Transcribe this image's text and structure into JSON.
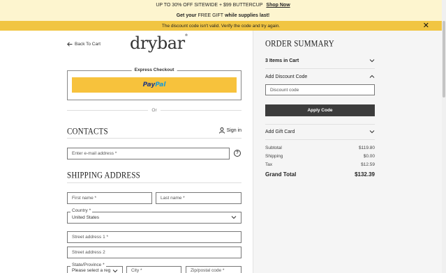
{
  "promo": {
    "line1": "UP TO 30% OFF SITEWIDE + $99 BUTTERCUP",
    "shop_now": "Shop Now",
    "line2_a": "Get your",
    "line2_b": "FREE GIFT",
    "line2_c": "while supplies last!"
  },
  "error": {
    "message": "The discount code isn't valid. Verify the code and try again.",
    "close_icon": "close-icon"
  },
  "header": {
    "back_label": "Back To Cart",
    "logo": "drybar",
    "logo_mark": "®"
  },
  "express": {
    "title": "Express Checkout",
    "paypal_a": "Pay",
    "paypal_b": "Pal",
    "or_label": "Or"
  },
  "contacts": {
    "title": "CONTACTS",
    "signin_label": "Sign in",
    "email_placeholder": "Enter e-mail address *"
  },
  "shipping": {
    "title": "SHIPPING ADDRESS",
    "first_name": "First name *",
    "last_name": "Last name *",
    "country_legend": "Country *",
    "country_value": "United States",
    "street1": "Street address 1 *",
    "street2": "Street address 2",
    "state_legend": "State/Province *",
    "state_value": "Please select a reg",
    "city": "City *",
    "zip": "Zip/postal code *"
  },
  "summary": {
    "title": "ORDER SUMMARY",
    "items_label": "3 Items in Cart",
    "discount_label": "Add Discount Code",
    "discount_placeholder": "Discount code",
    "apply_label": "Apply Code",
    "gift_label": "Add Gift Card",
    "rows": [
      {
        "label": "Subtotal",
        "value": "$119.80"
      },
      {
        "label": "Shipping",
        "value": "$0.00"
      },
      {
        "label": "Tax",
        "value": "$12.59"
      }
    ],
    "grand_total_label": "Grand Total",
    "grand_total_value": "$132.39"
  },
  "colors": {
    "promo_bg": "#fdf5cf",
    "error_bg": "#f1c542",
    "paypal_bg": "#f7c23c",
    "apply_bg": "#3c3c3c"
  }
}
